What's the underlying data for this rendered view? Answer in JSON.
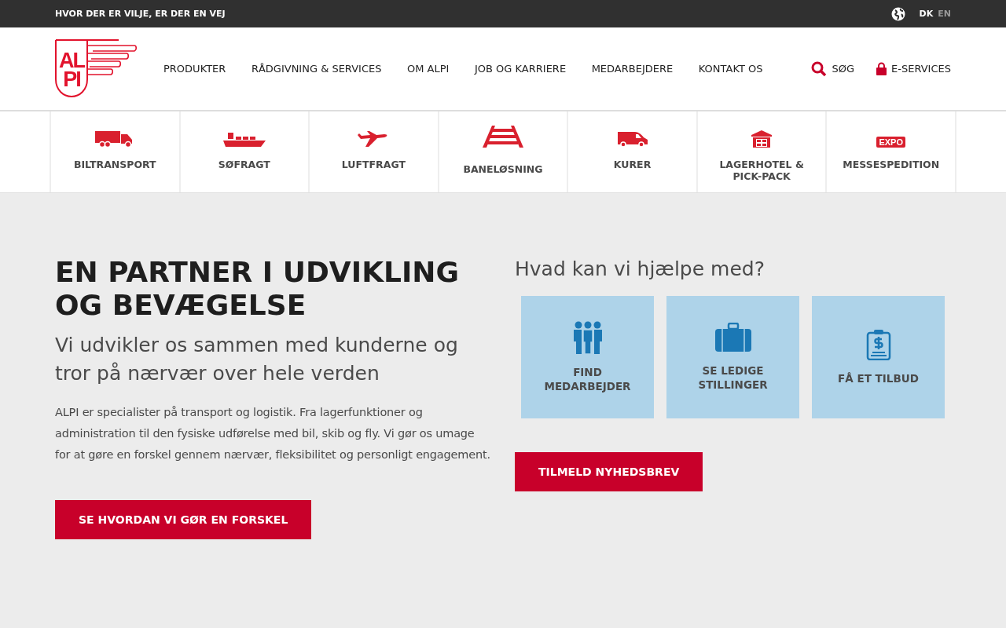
{
  "top_bar": {
    "tagline": "HVOR DER ER VILJE, ER DER EN VEJ",
    "languages": [
      {
        "label": "DK",
        "selected": true
      },
      {
        "label": "EN",
        "selected": false
      }
    ]
  },
  "header": {
    "logo": {
      "top": "AL",
      "bottom": "PI"
    },
    "nav": [
      "PRODUKTER",
      "RÅDGIVNING & SERVICES",
      "OM ALPI",
      "JOB OG KARRIERE",
      "MEDARBEJDERE",
      "KONTAKT OS"
    ],
    "search": "SØG",
    "eservices": "E-SERVICES"
  },
  "services": [
    {
      "kind": "truck",
      "label": "BILTRANSPORT"
    },
    {
      "kind": "ship",
      "label": "SØFRAGT"
    },
    {
      "kind": "plane",
      "label": "LUFTFRAGT"
    },
    {
      "kind": "rail",
      "label": "BANELØSNING"
    },
    {
      "kind": "van",
      "label": "KURER"
    },
    {
      "kind": "warehouse",
      "label": "LAGERHOTEL & PICK-PACK"
    },
    {
      "kind": "expo",
      "label": "MESSESPEDITION",
      "icon_text": "EXPO"
    }
  ],
  "intro": {
    "heading": "EN PARTNER I UDVIKLING OG BEVÆGELSE",
    "subheading": "Vi udvikler os sammen med kunderne og tror på nærvær over hele verden",
    "body": "ALPI er specialister på transport og logistik. Fra lagerfunktioner og administration til den fysiske udførelse med bil, skib og fly. Vi gør os umage for at gøre en forskel gennem nærvær, fleksibilitet og personligt engagement.",
    "button": "SE HVORDAN VI GØR EN FORSKEL"
  },
  "help": {
    "heading": "Hvad kan vi hjælpe med?",
    "tiles": [
      {
        "kind": "people",
        "label": "FIND MEDARBEJDER"
      },
      {
        "kind": "briefcase",
        "label": "SE LEDIGE STILLINGER"
      },
      {
        "kind": "quote",
        "label": "FÅ ET TILBUD"
      }
    ],
    "newsletter": "TILMELD NYHEDSBREV"
  }
}
